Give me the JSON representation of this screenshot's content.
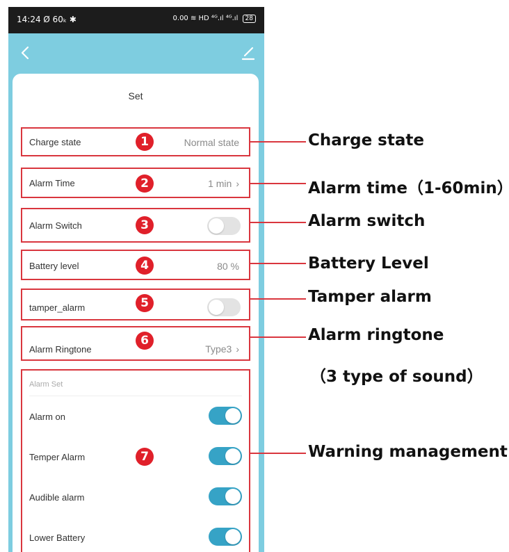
{
  "statusbar": {
    "time_icons": "14:24 Ø 60ₖ ✱",
    "right": "0.00 ≋ HD ⁴ᴳ.ıl ⁴ᴳ.ıl",
    "battery": "28"
  },
  "card": {
    "title": "Set"
  },
  "rows": {
    "charge": {
      "label": "Charge state",
      "value": "Normal state",
      "badge": "1"
    },
    "alarm_time": {
      "label": "Alarm Time",
      "value": "1 min",
      "badge": "2"
    },
    "alarm_switch": {
      "label": "Alarm Switch",
      "state": false,
      "badge": "3"
    },
    "battery": {
      "label": "Battery level",
      "value": "80 %",
      "badge": "4"
    },
    "tamper": {
      "label": "tamper_alarm",
      "state": false,
      "badge": "5"
    },
    "ringtone": {
      "label": "Alarm Ringtone",
      "value": "Type3",
      "badge": "6"
    }
  },
  "alarm_set": {
    "heading": "Alarm Set",
    "badge": "7",
    "items": [
      {
        "label": "Alarm on",
        "state": true
      },
      {
        "label": "Temper Alarm",
        "state": true
      },
      {
        "label": "Audible alarm",
        "state": true
      },
      {
        "label": "Lower Battery",
        "state": true
      }
    ]
  },
  "annotations": {
    "charge_state": "Charge state",
    "alarm_time": "Alarm time（1-60min）",
    "alarm_switch": "Alarm switch",
    "battery_level": "Battery Level",
    "tamper_alarm": "Tamper alarm",
    "alarm_ringtone": "Alarm ringtone",
    "ringtone_note": "（3 type of sound）",
    "warning_management": "Warning management"
  },
  "colors": {
    "accent": "#36a3c6",
    "highlight": "#d9363e",
    "header": "#7ecde0"
  }
}
